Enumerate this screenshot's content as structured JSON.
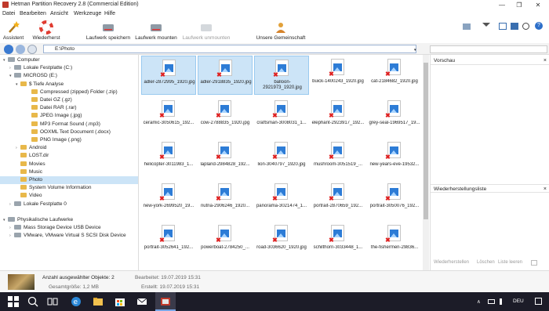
{
  "window": {
    "title": "Hetman Partition Recovery 2.8 (Commercial Edition)",
    "controls": {
      "minimize": "—",
      "maximize": "❐",
      "close": "✕"
    }
  },
  "menu": [
    "Datei",
    "Bearbeiten",
    "Ansicht",
    "Werkzeuge",
    "Hilfe"
  ],
  "toolbar": {
    "assistent": "Assistent",
    "wiederherst": "Wiederherst",
    "laufwerk_speichern": "Laufwerk speichern",
    "laufwerk_mounten": "Laufwerk mounten",
    "laufwerk_unmounten": "Laufwerk unmounten",
    "gemeinschaft": "Unsere Gemeinschaft"
  },
  "address": {
    "path": "E:\\Photo"
  },
  "tree": [
    {
      "label": "Computer",
      "level": 0,
      "icon": "computer-icon",
      "expander": "▾"
    },
    {
      "label": "Lokale Festplatte (C:)",
      "level": 1,
      "icon": "drive-icon",
      "expander": "›"
    },
    {
      "label": "MICROSD (E:)",
      "level": 1,
      "icon": "drive-icon",
      "expander": "▾"
    },
    {
      "label": "$ Tiefe Analyse",
      "level": 2,
      "icon": "folder-icon",
      "expander": "▾"
    },
    {
      "label": "Compressed (zipped) Folder (.zip)",
      "level": 3,
      "icon": "folder-icon",
      "expander": ""
    },
    {
      "label": "Datei GZ (.gz)",
      "level": 3,
      "icon": "folder-icon",
      "expander": ""
    },
    {
      "label": "Datei RAR (.rar)",
      "level": 3,
      "icon": "folder-icon",
      "expander": ""
    },
    {
      "label": "JPEG Image (.jpg)",
      "level": 3,
      "icon": "folder-icon",
      "expander": ""
    },
    {
      "label": "MP3 Format Sound (.mp3)",
      "level": 3,
      "icon": "folder-icon",
      "expander": ""
    },
    {
      "label": "OOXML Text Document (.docx)",
      "level": 3,
      "icon": "folder-icon",
      "expander": ""
    },
    {
      "label": "PNG Image (.png)",
      "level": 3,
      "icon": "folder-icon",
      "expander": ""
    },
    {
      "label": "Android",
      "level": 2,
      "icon": "folder-icon",
      "expander": "›"
    },
    {
      "label": "LOST.dir",
      "level": 2,
      "icon": "folder-icon",
      "expander": ""
    },
    {
      "label": "Movies",
      "level": 2,
      "icon": "folder-icon",
      "expander": ""
    },
    {
      "label": "Music",
      "level": 2,
      "icon": "folder-icon",
      "expander": ""
    },
    {
      "label": "Photo",
      "level": 2,
      "icon": "folder-icon",
      "expander": "",
      "selected": true
    },
    {
      "label": "System Volume Information",
      "level": 2,
      "icon": "folder-icon",
      "expander": ""
    },
    {
      "label": "Video",
      "level": 2,
      "icon": "folder-icon",
      "expander": ""
    },
    {
      "label": "Lokale Festplatte 0",
      "level": 1,
      "icon": "drive-icon",
      "expander": "›"
    },
    {
      "label": "",
      "level": 0,
      "icon": "",
      "expander": ""
    },
    {
      "label": "Physikalische Laufwerke",
      "level": 0,
      "icon": "drive-icon",
      "expander": "▾"
    },
    {
      "label": "Mass Storage Device USB Device",
      "level": 1,
      "icon": "drive-icon",
      "expander": "›"
    },
    {
      "label": "VMware, VMware Virtual S SCSI Disk Device",
      "level": 1,
      "icon": "drive-icon",
      "expander": "›"
    }
  ],
  "files": [
    {
      "name": "adler-2872995_1920.jpg",
      "selected": true
    },
    {
      "name": "adler-2918835_1920.jpg",
      "selected": true
    },
    {
      "name": "balloon-2921973_1920.jpg",
      "selected": true
    },
    {
      "name": "buick-1400243_1920.jpg",
      "selected": false
    },
    {
      "name": "cat-2184682_1920.jpg",
      "selected": false
    },
    {
      "name": "ceramic-3050615_192...",
      "selected": false
    },
    {
      "name": "cow-2788835_1920.jpg",
      "selected": false
    },
    {
      "name": "craftsman-3008031_1...",
      "selected": false
    },
    {
      "name": "elephant-2923917_192...",
      "selected": false
    },
    {
      "name": "grey-seal-1969517_19...",
      "selected": false
    },
    {
      "name": "helicopter-3011983_1...",
      "selected": false
    },
    {
      "name": "lapland-2984828_192...",
      "selected": false
    },
    {
      "name": "lion-3040797_1920.jpg",
      "selected": false
    },
    {
      "name": "mushroom-3051519_...",
      "selected": false
    },
    {
      "name": "new-years-eve-19532...",
      "selected": false
    },
    {
      "name": "new-york-2699520_19...",
      "selected": false
    },
    {
      "name": "nutria-2906246_1920...",
      "selected": false
    },
    {
      "name": "panorama-3021474_1...",
      "selected": false
    },
    {
      "name": "portrait-2870659_192...",
      "selected": false
    },
    {
      "name": "portrait-3050076_192...",
      "selected": false
    },
    {
      "name": "portrait-3052641_192...",
      "selected": false
    },
    {
      "name": "powerboat-2784250_...",
      "selected": false
    },
    {
      "name": "road-3036620_1920.jpg",
      "selected": false
    },
    {
      "name": "schilthorn-3033448_1...",
      "selected": false
    },
    {
      "name": "the-fishermen-29836...",
      "selected": false
    }
  ],
  "right_pane": {
    "preview_title": "Vorschau",
    "recovery_list_title": "Wiederherstellungsliste",
    "close": "×",
    "buttons": [
      "Wiederherstellen",
      "Löschen",
      "Liste leeren"
    ]
  },
  "status": {
    "selected_count": "Anzahl ausgewählter Objekte: 2",
    "total_size": "Gesamtgröße: 1,2 MB",
    "modified": "Bearbeitet:  19.07.2019 15:31",
    "created": "Erstellt:  19.07.2019 15:31"
  },
  "taskbar": {
    "language": "DEU",
    "tray_chevron": "∧"
  },
  "colors": {
    "accent": "#2d7cd6",
    "selection": "#cce4f7",
    "deleted_mark": "#e02020",
    "taskbar": "#1c1c28"
  }
}
